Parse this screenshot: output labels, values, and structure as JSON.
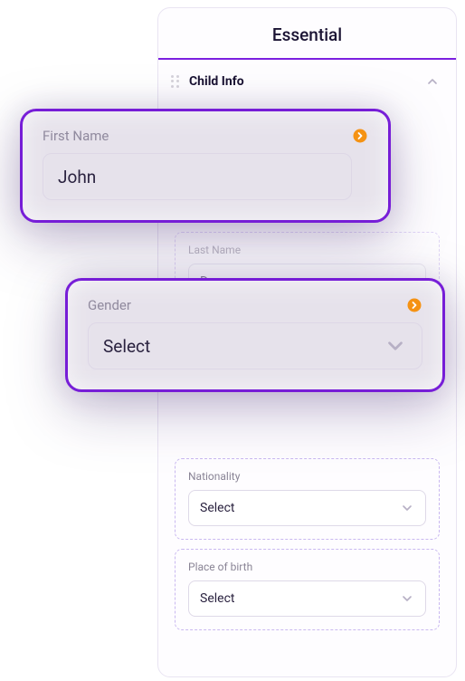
{
  "panel": {
    "title": "Essential",
    "section": "Child Info"
  },
  "fields": {
    "first_name": {
      "label": "First Name",
      "value": "John"
    },
    "last_name": {
      "label": "Last Name",
      "value": "D"
    },
    "gender": {
      "label": "Gender",
      "value": "Select"
    },
    "nationality": {
      "label": "Nationality",
      "value": "Select"
    },
    "place_of_birth": {
      "label": "Place of birth",
      "value": "Select"
    }
  }
}
